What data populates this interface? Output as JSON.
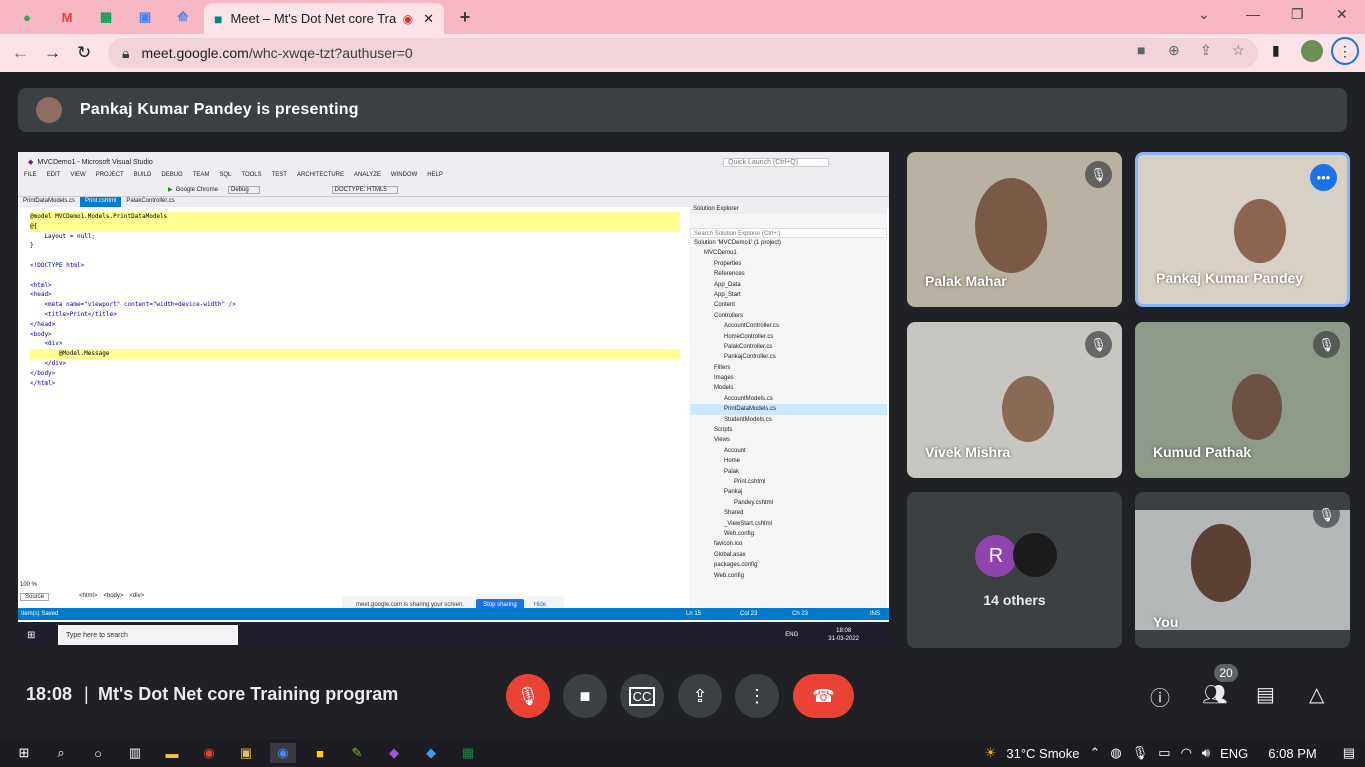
{
  "browser": {
    "tab_title": "Meet – Mt's Dot Net core Tra",
    "url_host": "meet.google.com",
    "url_path": "/whc-xwqe-tzt?authuser=0"
  },
  "meet": {
    "presenting_text": "Pankaj Kumar Pandey is presenting",
    "time": "18:08",
    "separator": "|",
    "meeting_title": "Mt's Dot Net core Training program",
    "participant_count": "20",
    "participants": [
      {
        "name": "Palak Mahar",
        "muted": true
      },
      {
        "name": "Pankaj Kumar Pandey",
        "muted": false
      },
      {
        "name": "Vivek Mishra",
        "muted": true
      },
      {
        "name": "Kumud Pathak",
        "muted": true
      },
      {
        "name": "You",
        "muted": true
      }
    ],
    "others_label": "14 others",
    "others_avatar_letter": "R"
  },
  "vs": {
    "title": "MVCDemo1 - Microsoft Visual Studio",
    "quick_launch": "Quick Launch (Ctrl+Q)",
    "menu": [
      "FILE",
      "EDIT",
      "VIEW",
      "PROJECT",
      "BUILD",
      "DEBUG",
      "TEAM",
      "SQL",
      "TOOLS",
      "TEST",
      "ARCHITECTURE",
      "ANALYZE",
      "WINDOW",
      "HELP"
    ],
    "toolbar_browser": "Google Chrome",
    "toolbar_config": "Debug",
    "toolbar_doctype": "DOCTYPE: HTML5",
    "tabs": [
      "PrintDataModels.cs",
      "Print.cshtml",
      "PalakController.cs"
    ],
    "code": [
      "@model MVCDemo1.Models.PrintDataModels",
      "@{",
      "    Layout = null;",
      "}",
      "",
      "<!DOCTYPE html>",
      "",
      "<html>",
      "<head>",
      "    <meta name=\"viewport\" content=\"width=device-width\" />",
      "    <title>Print</title>",
      "</head>",
      "<body>",
      "    <div>",
      "        @Model.Message",
      "    </div>",
      "</body>",
      "</html>"
    ],
    "solution_title": "Solution Explorer",
    "solution_search": "Search Solution Explorer (Ctrl+;)",
    "solution_items": [
      {
        "t": "Solution 'MVCDemo1' (1 project)",
        "d": 0
      },
      {
        "t": "MVCDemo1",
        "d": 1
      },
      {
        "t": "Properties",
        "d": 2
      },
      {
        "t": "References",
        "d": 2
      },
      {
        "t": "App_Data",
        "d": 2
      },
      {
        "t": "App_Start",
        "d": 2
      },
      {
        "t": "Content",
        "d": 2
      },
      {
        "t": "Controllers",
        "d": 2
      },
      {
        "t": "AccountController.cs",
        "d": 3
      },
      {
        "t": "HomeController.cs",
        "d": 3
      },
      {
        "t": "PalakController.cs",
        "d": 3
      },
      {
        "t": "PankajController.cs",
        "d": 3
      },
      {
        "t": "Filters",
        "d": 2
      },
      {
        "t": "Images",
        "d": 2
      },
      {
        "t": "Models",
        "d": 2
      },
      {
        "t": "AccountModels.cs",
        "d": 3
      },
      {
        "t": "PrintDataModels.cs",
        "d": 3,
        "sel": true
      },
      {
        "t": "StudentModels.cs",
        "d": 3
      },
      {
        "t": "Scripts",
        "d": 2
      },
      {
        "t": "Views",
        "d": 2
      },
      {
        "t": "Account",
        "d": 3
      },
      {
        "t": "Home",
        "d": 3
      },
      {
        "t": "Palak",
        "d": 3
      },
      {
        "t": "Print.cshtml",
        "d": 4
      },
      {
        "t": "Pankaj",
        "d": 3
      },
      {
        "t": "Pandey.cshtml",
        "d": 4
      },
      {
        "t": "Shared",
        "d": 3
      },
      {
        "t": "_ViewStart.cshtml",
        "d": 3
      },
      {
        "t": "Web.config",
        "d": 3
      },
      {
        "t": "favicon.ico",
        "d": 2
      },
      {
        "t": "Global.asax",
        "d": 2
      },
      {
        "t": "packages.config",
        "d": 2
      },
      {
        "t": "Web.config",
        "d": 2
      }
    ],
    "zoom": "100 %",
    "source_tab": "Source",
    "breadcrumb": [
      "<html>",
      "<body>",
      "<div>"
    ],
    "status": "Item(s) Saved",
    "status_ln": "Ln 15",
    "status_col": "Col 23",
    "status_ch": "Ch 23",
    "status_ins": "INS",
    "share_notice": "meet.google.com is sharing your screen.",
    "stop_sharing": "Stop sharing",
    "hide": "Hide",
    "taskbar_search": "Type here to search",
    "inner_lang": "ENG",
    "inner_time": "18:08",
    "inner_date": "31-03-2022"
  },
  "taskbar": {
    "weather": "31°C  Smoke",
    "lang": "ENG",
    "time": "6:08 PM"
  },
  "colors": {
    "accent": "#1a73e8",
    "danger": "#ea4335",
    "tabstrip": "#f6b6c2"
  }
}
